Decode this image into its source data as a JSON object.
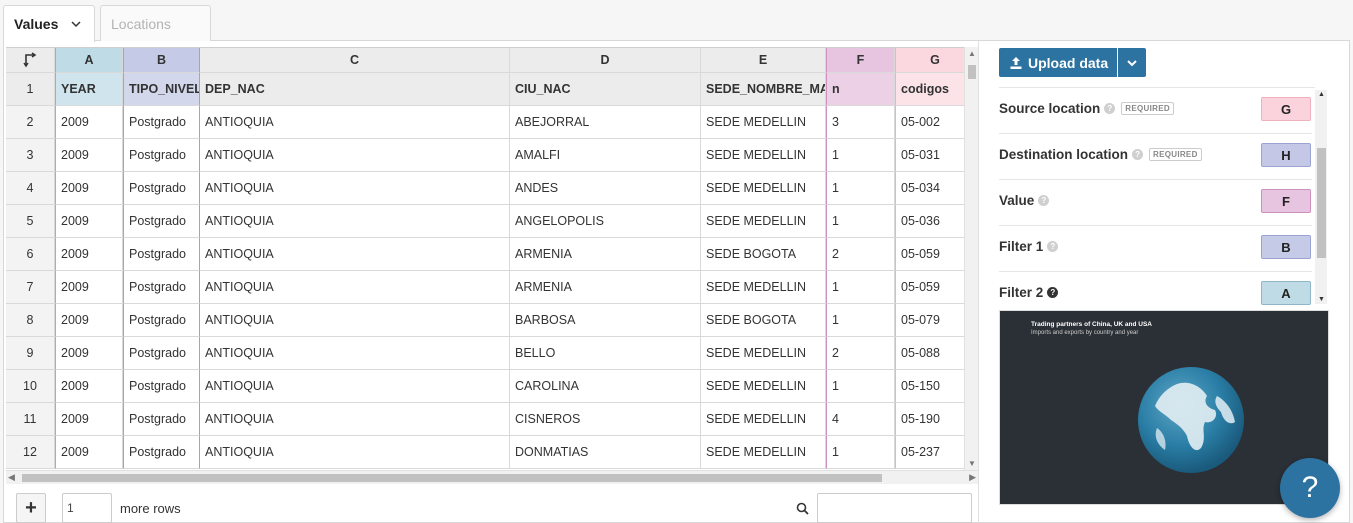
{
  "tabs": [
    {
      "label": "Values",
      "active": true
    },
    {
      "label": "Locations",
      "active": false
    }
  ],
  "grid": {
    "column_letters": [
      "A",
      "B",
      "C",
      "D",
      "E",
      "F",
      "G"
    ],
    "field_row_number": "1",
    "fields": [
      "YEAR",
      "TIPO_NIVEL",
      "DEP_NAC",
      "CIU_NAC",
      "SEDE_NOMBRE_MAT",
      "n",
      "codigos"
    ],
    "rows": [
      {
        "num": "2",
        "cells": [
          "2009",
          "Postgrado",
          "ANTIOQUIA",
          "ABEJORRAL",
          "SEDE MEDELLIN",
          "3",
          "05-002"
        ]
      },
      {
        "num": "3",
        "cells": [
          "2009",
          "Postgrado",
          "ANTIOQUIA",
          "AMALFI",
          "SEDE MEDELLIN",
          "1",
          "05-031"
        ]
      },
      {
        "num": "4",
        "cells": [
          "2009",
          "Postgrado",
          "ANTIOQUIA",
          "ANDES",
          "SEDE MEDELLIN",
          "1",
          "05-034"
        ]
      },
      {
        "num": "5",
        "cells": [
          "2009",
          "Postgrado",
          "ANTIOQUIA",
          "ANGELOPOLIS",
          "SEDE MEDELLIN",
          "1",
          "05-036"
        ]
      },
      {
        "num": "6",
        "cells": [
          "2009",
          "Postgrado",
          "ANTIOQUIA",
          "ARMENIA",
          "SEDE BOGOTA",
          "2",
          "05-059"
        ]
      },
      {
        "num": "7",
        "cells": [
          "2009",
          "Postgrado",
          "ANTIOQUIA",
          "ARMENIA",
          "SEDE MEDELLIN",
          "1",
          "05-059"
        ]
      },
      {
        "num": "8",
        "cells": [
          "2009",
          "Postgrado",
          "ANTIOQUIA",
          "BARBOSA",
          "SEDE BOGOTA",
          "1",
          "05-079"
        ]
      },
      {
        "num": "9",
        "cells": [
          "2009",
          "Postgrado",
          "ANTIOQUIA",
          "BELLO",
          "SEDE MEDELLIN",
          "2",
          "05-088"
        ]
      },
      {
        "num": "10",
        "cells": [
          "2009",
          "Postgrado",
          "ANTIOQUIA",
          "CAROLINA",
          "SEDE MEDELLIN",
          "1",
          "05-150"
        ]
      },
      {
        "num": "11",
        "cells": [
          "2009",
          "Postgrado",
          "ANTIOQUIA",
          "CISNEROS",
          "SEDE MEDELLIN",
          "4",
          "05-190"
        ]
      },
      {
        "num": "12",
        "cells": [
          "2009",
          "Postgrado",
          "ANTIOQUIA",
          "DONMATIAS",
          "SEDE MEDELLIN",
          "1",
          "05-237"
        ]
      }
    ]
  },
  "bottom_bar": {
    "add_label": "+",
    "rows_value": "1",
    "more_rows_label": "more rows"
  },
  "sidebar": {
    "upload_label": "Upload data",
    "required_label": "REQUIRED",
    "bindings": [
      {
        "label": "Source location",
        "required": true,
        "column": "G"
      },
      {
        "label": "Destination location",
        "required": true,
        "column": "H"
      },
      {
        "label": "Value",
        "required": false,
        "column": "F"
      },
      {
        "label": "Filter 1",
        "required": false,
        "column": "B"
      },
      {
        "label": "Filter 2",
        "required": false,
        "column": "A"
      }
    ],
    "preview": {
      "title": "Trading partners of China, UK and USA",
      "subtitle": "Imports and exports by country and year"
    },
    "help_label": "?"
  },
  "colors": {
    "accent": "#2c73a2",
    "col_a": "#bfdbe6",
    "col_b": "#c5cbe6",
    "col_f": "#e7c4df",
    "col_g": "#fbd8df",
    "col_h": "#c5c7e6"
  }
}
